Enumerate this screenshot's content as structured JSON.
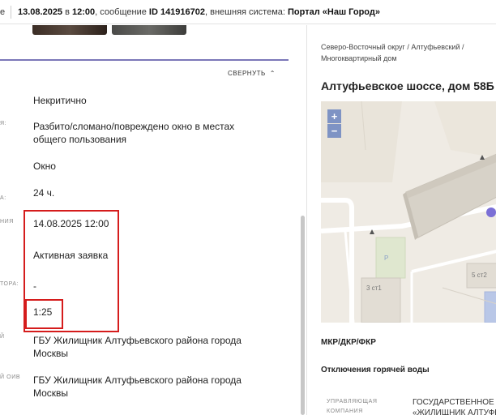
{
  "header": {
    "cut_prefix": "е",
    "date": "13.08.2025",
    "in_text": " в ",
    "time": "12:00",
    "msg_text": ", сообщение ",
    "msg_id": "ID 141916702",
    "ext_text": ", внешняя система: ",
    "ext_system": "Портал «Наш Город»"
  },
  "details": {
    "collapse_label": "СВЕРНУТЬ",
    "rows": [
      {
        "label": "",
        "value": "Некритично"
      },
      {
        "label": "Я:",
        "value": "Разбито/сломано/повреждено окно в местах общего пользования"
      },
      {
        "label": "",
        "value": "Окно"
      },
      {
        "label": "А:",
        "value": "24 ч."
      },
      {
        "label": "НИЯ",
        "value": "14.08.2025 12:00"
      },
      {
        "label": "",
        "value": "Активная заявка"
      },
      {
        "label": "ТОРА:",
        "value": "-"
      },
      {
        "label": "",
        "value": "1:25"
      },
      {
        "label": "Й",
        "value": "ГБУ Жилищник Алтуфьевского района города Москвы"
      },
      {
        "label": "Й ОИВ",
        "value": "ГБУ Жилищник Алтуфьевского района города Москвы"
      }
    ]
  },
  "location": {
    "breadcrumb": "Северо-Восточный округ / Алтуфьевский / Многоквартирный дом",
    "address": "Алтуфьевское шоссе, дом 58Б",
    "map": {
      "zoom_in": "+",
      "zoom_out": "−",
      "labels": [
        "3 ст1",
        "5 ст2"
      ],
      "parking": "P",
      "marker_color": "#7b6fd6"
    },
    "mkr": "МКР/ДКР/ФКР",
    "hot_water": "Отключения горячей воды",
    "management_label": "УПРАВЛЯЮЩАЯ КОМПАНИЯ",
    "management_value_1": "ГОСУДАРСТВЕННОЕ БК",
    "management_value_2": "«ЖИЛИЩНИК АЛТУФЬ"
  },
  "colors": {
    "accent_line": "#7b77b8",
    "highlight": "#d51c1c",
    "zoom_button": "#7e93c4"
  }
}
